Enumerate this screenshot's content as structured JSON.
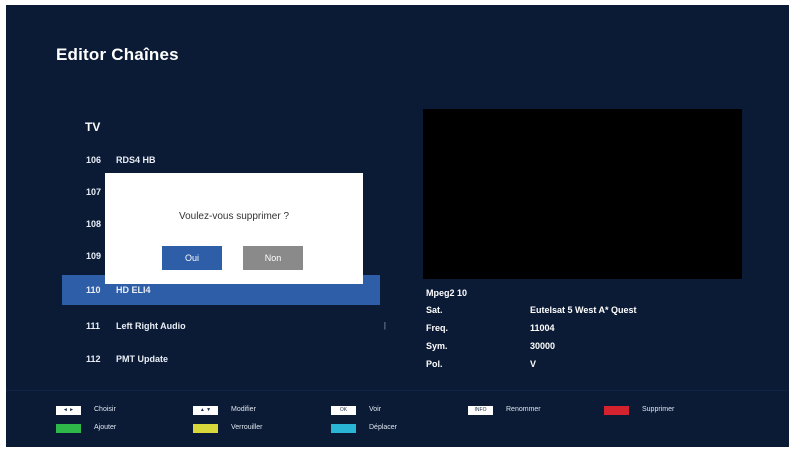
{
  "screen": {
    "title": "Editor Chaînes"
  },
  "list": {
    "header": "TV",
    "rows": [
      {
        "num": "106",
        "name": "RDS4 HB"
      },
      {
        "num": "107",
        "name": ""
      },
      {
        "num": "108",
        "name": ""
      },
      {
        "num": "109",
        "name": ""
      },
      {
        "num": "110",
        "name": "HD ELI4"
      },
      {
        "num": "111",
        "name": "Left Right Audio"
      },
      {
        "num": "112",
        "name": "PMT Update"
      }
    ],
    "selected_index": 4
  },
  "info": {
    "title": "Mpeg2 10",
    "rows": [
      {
        "key": "Sat.",
        "value": "Eutelsat 5 West A* Quest"
      },
      {
        "key": "Freq.",
        "value": "11004"
      },
      {
        "key": "Sym.",
        "value": "30000"
      },
      {
        "key": "Pol.",
        "value": "V"
      }
    ]
  },
  "dialog": {
    "message": "Voulez-vous supprimer ?",
    "yes_label": "Oui",
    "no_label": "Non"
  },
  "footer": {
    "keys": [
      {
        "swatch": "◄ ►",
        "label": "Choisir"
      },
      {
        "swatch": "▲ ▼",
        "label": "Modifier"
      },
      {
        "swatch": "OK",
        "label": "Voir"
      },
      {
        "swatch": "INFO",
        "label": "Renommer"
      },
      {
        "swatch": "",
        "color": "#d4232f",
        "label": "Supprimer"
      },
      {
        "swatch": "",
        "color": "#2fb84a",
        "label": "Ajouter"
      },
      {
        "swatch": "",
        "color": "#d8d83a",
        "label": "Verrouiller"
      },
      {
        "swatch": "",
        "color": "#29b5d6",
        "label": "Déplacer"
      }
    ]
  },
  "colors": {
    "background": "#0b1b35",
    "selection": "#2f5ea8",
    "button_no": "#8a8a8a"
  }
}
